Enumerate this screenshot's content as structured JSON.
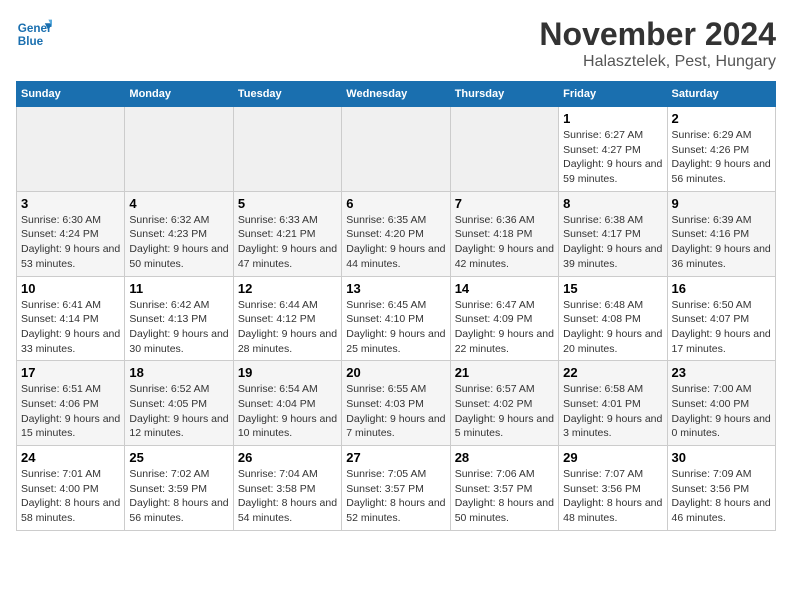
{
  "logo": {
    "text_general": "General",
    "text_blue": "Blue"
  },
  "title": "November 2024",
  "subtitle": "Halasztelek, Pest, Hungary",
  "days_of_week": [
    "Sunday",
    "Monday",
    "Tuesday",
    "Wednesday",
    "Thursday",
    "Friday",
    "Saturday"
  ],
  "weeks": [
    [
      {
        "day": "",
        "empty": true
      },
      {
        "day": "",
        "empty": true
      },
      {
        "day": "",
        "empty": true
      },
      {
        "day": "",
        "empty": true
      },
      {
        "day": "",
        "empty": true
      },
      {
        "day": "1",
        "sunrise": "Sunrise: 6:27 AM",
        "sunset": "Sunset: 4:27 PM",
        "daylight": "Daylight: 9 hours and 59 minutes."
      },
      {
        "day": "2",
        "sunrise": "Sunrise: 6:29 AM",
        "sunset": "Sunset: 4:26 PM",
        "daylight": "Daylight: 9 hours and 56 minutes."
      }
    ],
    [
      {
        "day": "3",
        "sunrise": "Sunrise: 6:30 AM",
        "sunset": "Sunset: 4:24 PM",
        "daylight": "Daylight: 9 hours and 53 minutes."
      },
      {
        "day": "4",
        "sunrise": "Sunrise: 6:32 AM",
        "sunset": "Sunset: 4:23 PM",
        "daylight": "Daylight: 9 hours and 50 minutes."
      },
      {
        "day": "5",
        "sunrise": "Sunrise: 6:33 AM",
        "sunset": "Sunset: 4:21 PM",
        "daylight": "Daylight: 9 hours and 47 minutes."
      },
      {
        "day": "6",
        "sunrise": "Sunrise: 6:35 AM",
        "sunset": "Sunset: 4:20 PM",
        "daylight": "Daylight: 9 hours and 44 minutes."
      },
      {
        "day": "7",
        "sunrise": "Sunrise: 6:36 AM",
        "sunset": "Sunset: 4:18 PM",
        "daylight": "Daylight: 9 hours and 42 minutes."
      },
      {
        "day": "8",
        "sunrise": "Sunrise: 6:38 AM",
        "sunset": "Sunset: 4:17 PM",
        "daylight": "Daylight: 9 hours and 39 minutes."
      },
      {
        "day": "9",
        "sunrise": "Sunrise: 6:39 AM",
        "sunset": "Sunset: 4:16 PM",
        "daylight": "Daylight: 9 hours and 36 minutes."
      }
    ],
    [
      {
        "day": "10",
        "sunrise": "Sunrise: 6:41 AM",
        "sunset": "Sunset: 4:14 PM",
        "daylight": "Daylight: 9 hours and 33 minutes."
      },
      {
        "day": "11",
        "sunrise": "Sunrise: 6:42 AM",
        "sunset": "Sunset: 4:13 PM",
        "daylight": "Daylight: 9 hours and 30 minutes."
      },
      {
        "day": "12",
        "sunrise": "Sunrise: 6:44 AM",
        "sunset": "Sunset: 4:12 PM",
        "daylight": "Daylight: 9 hours and 28 minutes."
      },
      {
        "day": "13",
        "sunrise": "Sunrise: 6:45 AM",
        "sunset": "Sunset: 4:10 PM",
        "daylight": "Daylight: 9 hours and 25 minutes."
      },
      {
        "day": "14",
        "sunrise": "Sunrise: 6:47 AM",
        "sunset": "Sunset: 4:09 PM",
        "daylight": "Daylight: 9 hours and 22 minutes."
      },
      {
        "day": "15",
        "sunrise": "Sunrise: 6:48 AM",
        "sunset": "Sunset: 4:08 PM",
        "daylight": "Daylight: 9 hours and 20 minutes."
      },
      {
        "day": "16",
        "sunrise": "Sunrise: 6:50 AM",
        "sunset": "Sunset: 4:07 PM",
        "daylight": "Daylight: 9 hours and 17 minutes."
      }
    ],
    [
      {
        "day": "17",
        "sunrise": "Sunrise: 6:51 AM",
        "sunset": "Sunset: 4:06 PM",
        "daylight": "Daylight: 9 hours and 15 minutes."
      },
      {
        "day": "18",
        "sunrise": "Sunrise: 6:52 AM",
        "sunset": "Sunset: 4:05 PM",
        "daylight": "Daylight: 9 hours and 12 minutes."
      },
      {
        "day": "19",
        "sunrise": "Sunrise: 6:54 AM",
        "sunset": "Sunset: 4:04 PM",
        "daylight": "Daylight: 9 hours and 10 minutes."
      },
      {
        "day": "20",
        "sunrise": "Sunrise: 6:55 AM",
        "sunset": "Sunset: 4:03 PM",
        "daylight": "Daylight: 9 hours and 7 minutes."
      },
      {
        "day": "21",
        "sunrise": "Sunrise: 6:57 AM",
        "sunset": "Sunset: 4:02 PM",
        "daylight": "Daylight: 9 hours and 5 minutes."
      },
      {
        "day": "22",
        "sunrise": "Sunrise: 6:58 AM",
        "sunset": "Sunset: 4:01 PM",
        "daylight": "Daylight: 9 hours and 3 minutes."
      },
      {
        "day": "23",
        "sunrise": "Sunrise: 7:00 AM",
        "sunset": "Sunset: 4:00 PM",
        "daylight": "Daylight: 9 hours and 0 minutes."
      }
    ],
    [
      {
        "day": "24",
        "sunrise": "Sunrise: 7:01 AM",
        "sunset": "Sunset: 4:00 PM",
        "daylight": "Daylight: 8 hours and 58 minutes."
      },
      {
        "day": "25",
        "sunrise": "Sunrise: 7:02 AM",
        "sunset": "Sunset: 3:59 PM",
        "daylight": "Daylight: 8 hours and 56 minutes."
      },
      {
        "day": "26",
        "sunrise": "Sunrise: 7:04 AM",
        "sunset": "Sunset: 3:58 PM",
        "daylight": "Daylight: 8 hours and 54 minutes."
      },
      {
        "day": "27",
        "sunrise": "Sunrise: 7:05 AM",
        "sunset": "Sunset: 3:57 PM",
        "daylight": "Daylight: 8 hours and 52 minutes."
      },
      {
        "day": "28",
        "sunrise": "Sunrise: 7:06 AM",
        "sunset": "Sunset: 3:57 PM",
        "daylight": "Daylight: 8 hours and 50 minutes."
      },
      {
        "day": "29",
        "sunrise": "Sunrise: 7:07 AM",
        "sunset": "Sunset: 3:56 PM",
        "daylight": "Daylight: 8 hours and 48 minutes."
      },
      {
        "day": "30",
        "sunrise": "Sunrise: 7:09 AM",
        "sunset": "Sunset: 3:56 PM",
        "daylight": "Daylight: 8 hours and 46 minutes."
      }
    ]
  ]
}
